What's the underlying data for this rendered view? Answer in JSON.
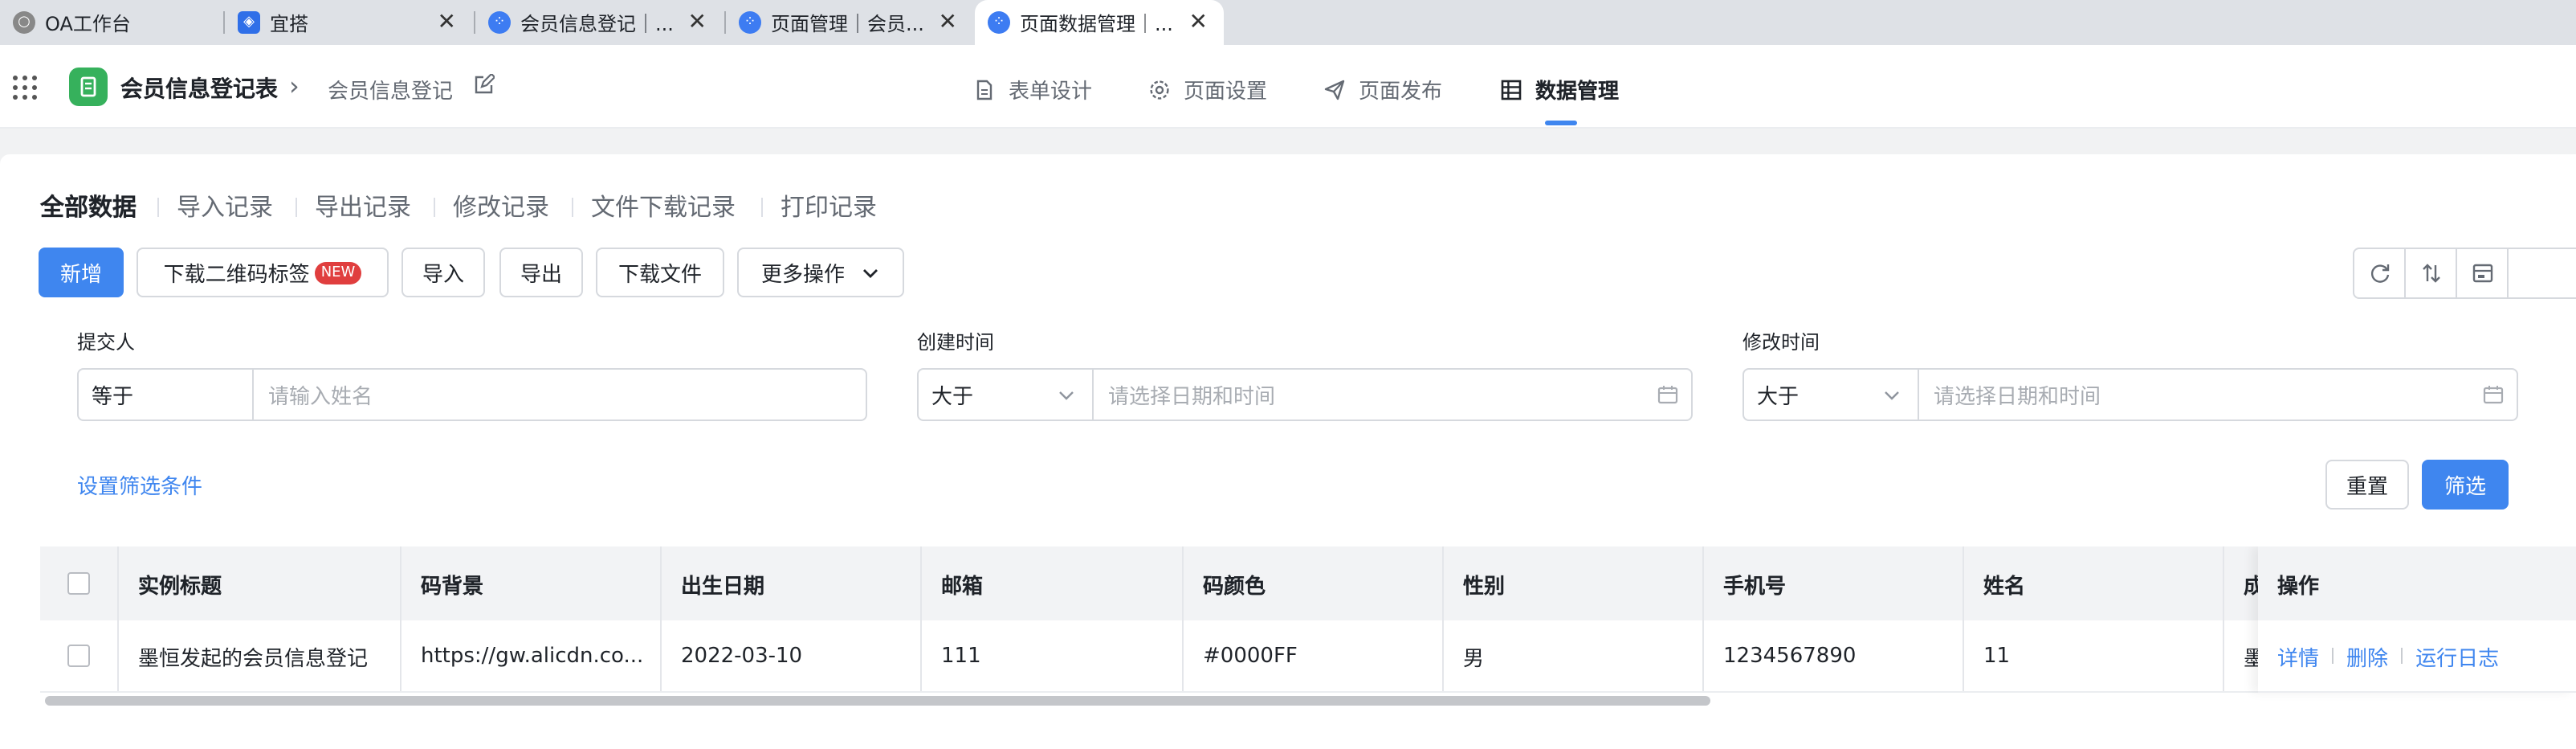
{
  "browser_tabs": [
    {
      "label": "OA工作台",
      "close": ""
    },
    {
      "label": "宜搭",
      "close": "✕"
    },
    {
      "label": "会员信息登记｜...",
      "close": "✕"
    },
    {
      "label": "页面管理｜会员...",
      "close": "✕"
    },
    {
      "label": "页面数据管理｜...",
      "close": "✕"
    }
  ],
  "header": {
    "form_title": "会员信息登记表",
    "breadcrumb_sep": "›",
    "page_name": "会员信息登记",
    "nav": [
      {
        "label": "表单设计",
        "icon": "file-icon"
      },
      {
        "label": "页面设置",
        "icon": "gear-icon"
      },
      {
        "label": "页面发布",
        "icon": "send-icon"
      },
      {
        "label": "数据管理",
        "icon": "table-icon",
        "active": true
      }
    ]
  },
  "subtabs": [
    "全部数据",
    "导入记录",
    "导出记录",
    "修改记录",
    "文件下载记录",
    "打印记录"
  ],
  "toolbar": {
    "add": "新增",
    "download_qr": "下载二维码标签",
    "new_badge": "NEW",
    "import": "导入",
    "export": "导出",
    "download_file": "下载文件",
    "more": "更多操作"
  },
  "filters": {
    "submitter": {
      "label": "提交人",
      "op": "等于",
      "placeholder": "请输入姓名"
    },
    "created": {
      "label": "创建时间",
      "op": "大于",
      "placeholder": "请选择日期和时间"
    },
    "modified": {
      "label": "修改时间",
      "op": "大于",
      "placeholder": "请选择日期和时间"
    },
    "set_conditions": "设置筛选条件",
    "reset": "重置",
    "apply": "筛选"
  },
  "table": {
    "columns": [
      "实例标题",
      "码背景",
      "出生日期",
      "邮箱",
      "码颜色",
      "性别",
      "手机号",
      "姓名",
      "成"
    ],
    "ops_header": "操作",
    "rows": [
      {
        "cells": [
          "墨恒发起的会员信息登记",
          "https://gw.alicdn.co...",
          "2022-03-10",
          "111",
          "#0000FF",
          "男",
          "1234567890",
          "11",
          "墨"
        ],
        "actions": [
          "详情",
          "删除",
          "运行日志"
        ]
      }
    ]
  },
  "colors": {
    "primary": "#3f86ef",
    "app_green": "#36b15c",
    "badge_red": "#e03e3e"
  }
}
